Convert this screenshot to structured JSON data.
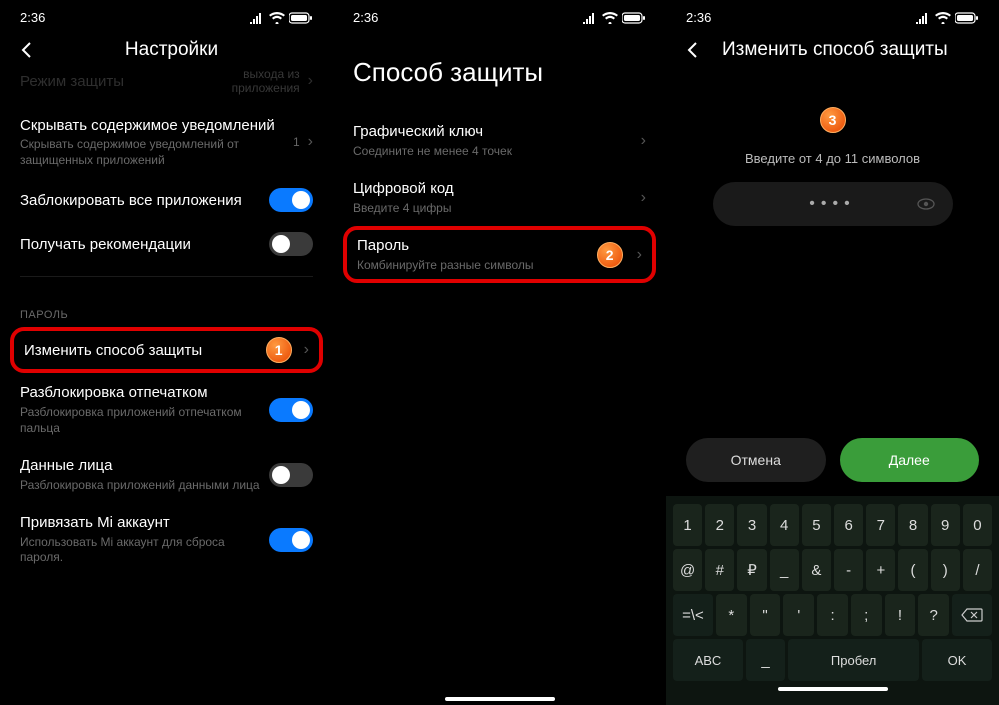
{
  "status": {
    "time": "2:36"
  },
  "p1": {
    "title": "Настройки",
    "row0": {
      "title": "Режим защиты",
      "sub": "выхода из приложения"
    },
    "row1": {
      "title": "Скрывать содержимое уведомлений",
      "sub": "Скрывать содержимое уведомлений от защищенных приложений",
      "val": "1"
    },
    "row2": {
      "title": "Заблокировать все приложения"
    },
    "row3": {
      "title": "Получать рекомендации"
    },
    "section": "ПАРОЛЬ",
    "row4": {
      "title": "Изменить способ защиты"
    },
    "row5": {
      "title": "Разблокировка отпечатком",
      "sub": "Разблокировка приложений отпечатком пальца"
    },
    "row6": {
      "title": "Данные лица",
      "sub": "Разблокировка приложений данными лица"
    },
    "row7": {
      "title": "Привязать Mi аккаунт",
      "sub": "Использовать Mi аккаунт для сброса пароля."
    }
  },
  "p2": {
    "title": "Способ защиты",
    "r1": {
      "title": "Графический ключ",
      "sub": "Соедините не менее 4 точек"
    },
    "r2": {
      "title": "Цифровой код",
      "sub": "Введите 4 цифры"
    },
    "r3": {
      "title": "Пароль",
      "sub": "Комбинируйте разные символы"
    }
  },
  "p3": {
    "title": "Изменить способ защиты",
    "prompt": "Введите от 4 до 11 символов",
    "pwd": "••••",
    "cancel": "Отмена",
    "next": "Далее",
    "kb": {
      "r1": [
        "1",
        "2",
        "3",
        "4",
        "5",
        "6",
        "7",
        "8",
        "9",
        "0"
      ],
      "r2": [
        "@",
        "#",
        "₽",
        "_",
        "&",
        "-",
        "+",
        "(",
        ")",
        "/"
      ],
      "r3a": "=\\<",
      "r3": [
        "*",
        "\"",
        "'",
        ":",
        ";",
        "!",
        "?"
      ],
      "r3b": "⌫",
      "r4a": "ABC",
      "r4s": "Пробел",
      "r4o": "OK"
    }
  },
  "badges": {
    "b1": "1",
    "b2": "2",
    "b3": "3"
  }
}
